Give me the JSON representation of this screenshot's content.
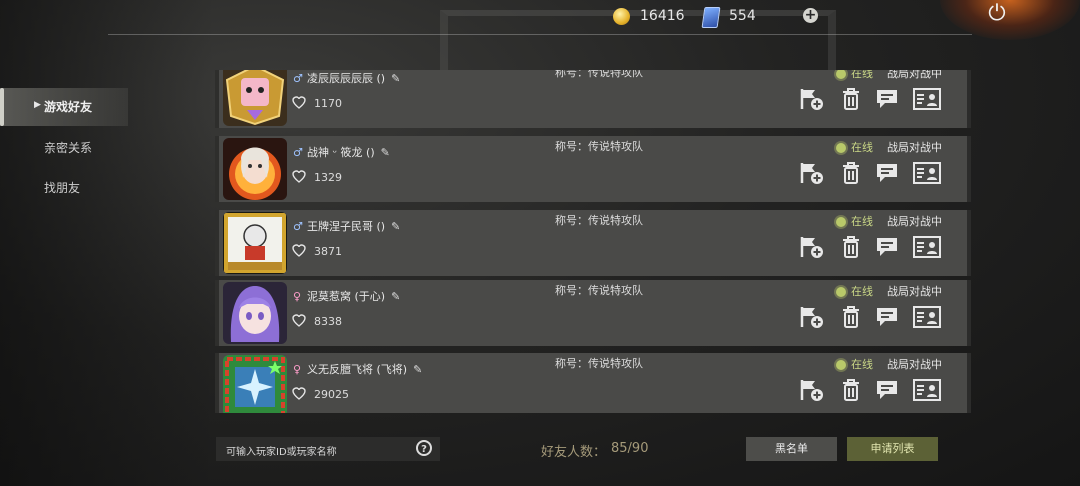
{
  "topbar": {
    "coins": "16416",
    "cards": "554"
  },
  "sidebar": {
    "items": [
      {
        "label": "游戏好友",
        "active": true
      },
      {
        "label": "亲密关系",
        "active": false
      },
      {
        "label": "找朋友",
        "active": false
      }
    ]
  },
  "friends": [
    {
      "gender": "male",
      "gender_symbol": "♂",
      "name": "凌辰辰辰辰辰 ()",
      "hearts": "1170",
      "title": "称号：传说特攻队",
      "status": "在线",
      "activity": "战局对战中"
    },
    {
      "gender": "male",
      "gender_symbol": "♂",
      "name": "战神 ᵕ 筱龙 ()",
      "hearts": "1329",
      "title": "称号：传说特攻队",
      "status": "在线",
      "activity": "战局对战中"
    },
    {
      "gender": "male",
      "gender_symbol": "♂",
      "name": "王牌涅子民哥 ()",
      "hearts": "3871",
      "title": "称号：传说特攻队",
      "status": "在线",
      "activity": "战局对战中"
    },
    {
      "gender": "female",
      "gender_symbol": "♀",
      "name": "泥莫惹窝 (于心)",
      "hearts": "8338",
      "title": "称号：传说特攻队",
      "status": "在线",
      "activity": "战局对战中"
    },
    {
      "gender": "female",
      "gender_symbol": "♀",
      "name": "义无反膻飞将 (飞将)",
      "hearts": "29025",
      "title": "称号：传说特攻队",
      "status": "在线",
      "activity": "战局对战中"
    }
  ],
  "bottom": {
    "search_placeholder": "可输入玩家ID或玩家名称",
    "friend_count_label": "好友人数：",
    "friend_count_value": "85/90",
    "blacklist_label": "黑名单",
    "apply_list_label": "申请列表"
  },
  "colors": {
    "online": "#b9c96a",
    "male": "#9fc3ff",
    "female": "#ff9ecb",
    "apply_button": "#5c6136"
  }
}
